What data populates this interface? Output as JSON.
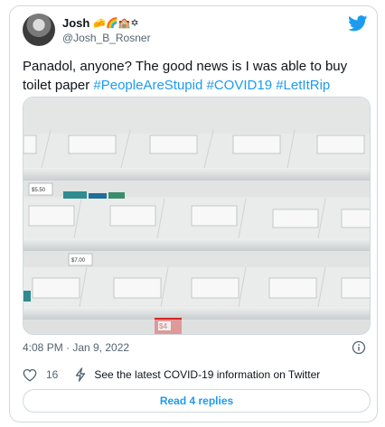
{
  "author": {
    "name": "Josh",
    "emojis": "🧀🌈🏫✡",
    "handle": "@Josh_B_Rosner"
  },
  "tweet": {
    "text_plain": "Panadol, anyone? The good news is I was able to buy toilet paper ",
    "hashtags": [
      "#PeopleAreStupid",
      "#COVID19",
      "#LetItRip"
    ]
  },
  "photo": {
    "price_tags": [
      "$5.50",
      "$7.00",
      "$4"
    ]
  },
  "timestamp": "4:08 PM · Jan 9, 2022",
  "actions": {
    "like_count": "16",
    "covid_info": "See the latest COVID-19 information on Twitter"
  },
  "replies_button": "Read 4 replies",
  "colors": {
    "accent": "#1d9bf0",
    "like_heart": "#536471",
    "border": "#cfd9de"
  },
  "icons": [
    "twitter-bird-icon",
    "info-icon",
    "heart-icon",
    "covid-info-icon"
  ]
}
